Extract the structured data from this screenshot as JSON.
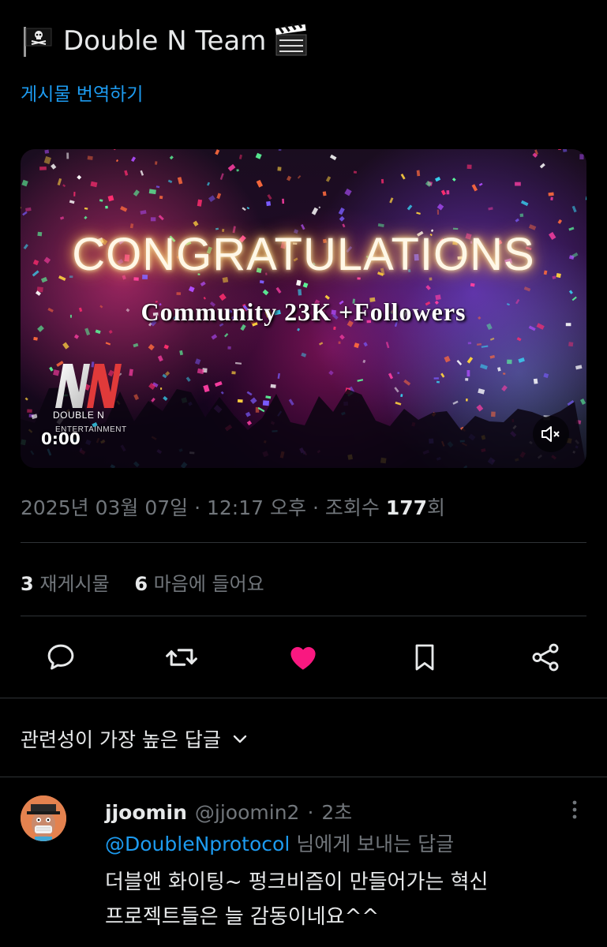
{
  "post": {
    "author_display": "Double N Team",
    "emoji_left": "pirate-flag-emoji",
    "emoji_right": "clapper-board-emoji",
    "translate_label": "게시물 번역하기"
  },
  "media": {
    "headline": "CONGRATULATIONS",
    "subline": "Community 23K +Followers",
    "logo_brand": "DOUBLE N",
    "logo_sub": "ENTERTAINMENT",
    "timecode": "0:00",
    "mute_icon": "speaker-muted-icon"
  },
  "meta": {
    "date": "2025년 03월 07일",
    "time": "12:17 오후",
    "views_label": "조회수",
    "views_count": "177",
    "views_suffix": "회",
    "separator": "·"
  },
  "stats": {
    "reposts_count": "3",
    "reposts_label": "재게시물",
    "likes_count": "6",
    "likes_label": "마음에 들어요"
  },
  "actions": [
    {
      "name": "reply-icon"
    },
    {
      "name": "repost-icon"
    },
    {
      "name": "like-icon-filled",
      "color": "#f91880"
    },
    {
      "name": "bookmark-icon"
    },
    {
      "name": "share-icon"
    }
  ],
  "replies_sort": {
    "label": "관련성이 가장 높은 답글"
  },
  "reply": {
    "name": "jjoomin",
    "handle": "@jjoomin2",
    "time": "2초",
    "separator": "·",
    "replying_mention": "@DoubleNprotocol",
    "replying_suffix": "님에게 보내는 답글",
    "text_line1": "더블앤 화이팅~ 펑크비즘이 만들어가는 혁신",
    "text_line2": "프로젝트들은 늘 감동이네요^^"
  },
  "colors": {
    "accent": "#1d9bf0",
    "like": "#f91880",
    "muted": "#71767b",
    "text": "#e7e9ea",
    "background": "#000000"
  }
}
